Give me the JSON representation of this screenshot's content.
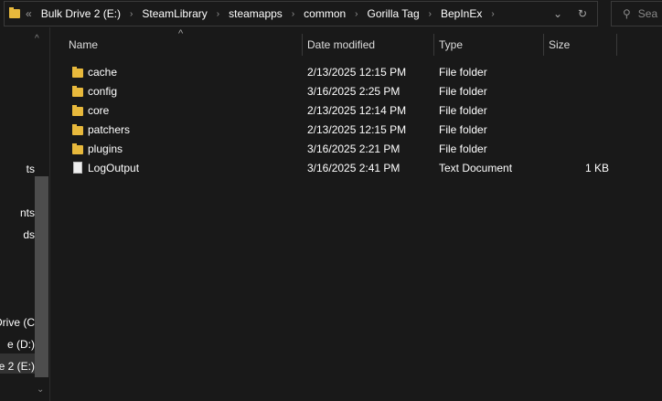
{
  "address": {
    "back_label": "«",
    "crumbs": [
      "Bulk Drive 2 (E:)",
      "SteamLibrary",
      "steamapps",
      "common",
      "Gorilla Tag",
      "BepInEx"
    ]
  },
  "search": {
    "placeholder": "Sea"
  },
  "columns": {
    "name": "Name",
    "date": "Date modified",
    "type": "Type",
    "size": "Size"
  },
  "files": [
    {
      "name": "cache",
      "date": "2/13/2025 12:15 PM",
      "type": "File folder",
      "size": "",
      "icon": "folder-icon"
    },
    {
      "name": "config",
      "date": "3/16/2025 2:25 PM",
      "type": "File folder",
      "size": "",
      "icon": "folder-icon"
    },
    {
      "name": "core",
      "date": "2/13/2025 12:14 PM",
      "type": "File folder",
      "size": "",
      "icon": "folder-icon"
    },
    {
      "name": "patchers",
      "date": "2/13/2025 12:15 PM",
      "type": "File folder",
      "size": "",
      "icon": "folder-icon"
    },
    {
      "name": "plugins",
      "date": "3/16/2025 2:21 PM",
      "type": "File folder",
      "size": "",
      "icon": "folder-icon"
    },
    {
      "name": "LogOutput",
      "date": "3/16/2025 2:41 PM",
      "type": "Text Document",
      "size": "1 KB",
      "icon": "document-icon"
    }
  ],
  "sidebar": {
    "items": [
      "ts",
      "nts",
      "ds",
      "Drive (C",
      "e (D:)",
      "e 2 (E:)"
    ]
  }
}
